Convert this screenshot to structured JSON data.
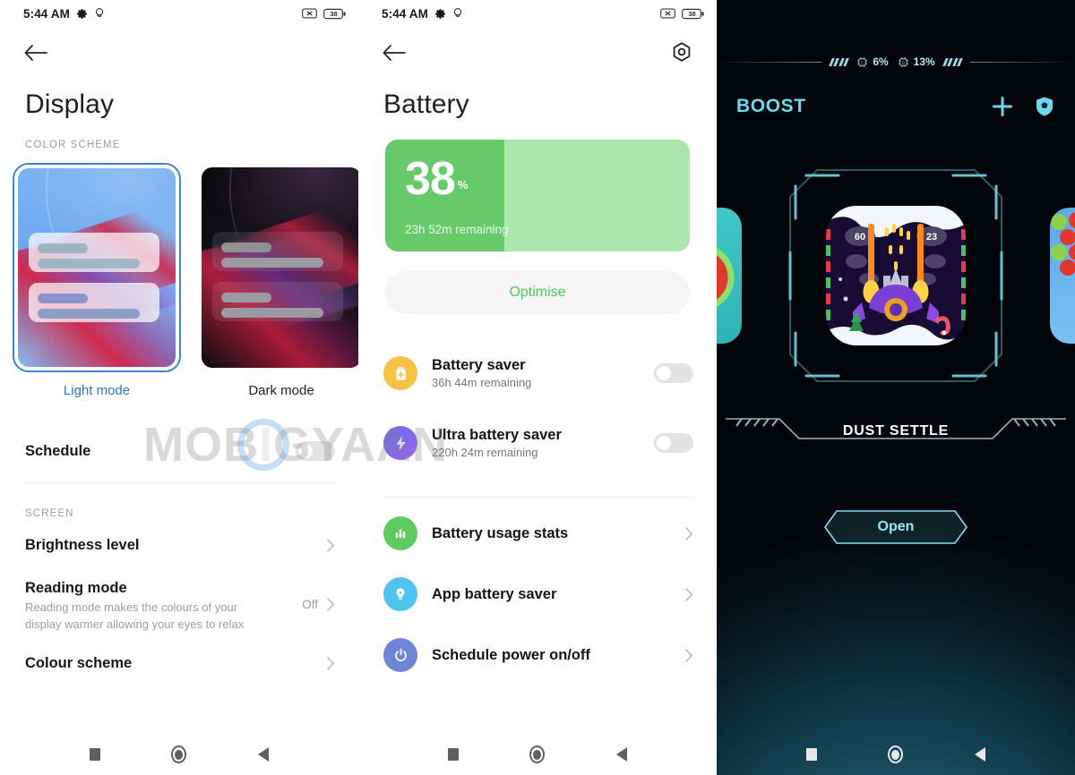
{
  "status_bar": {
    "time": "5:44 AM",
    "icons_left": [
      "gear-icon",
      "location-icon"
    ],
    "icons_right": [
      "no-sim-icon",
      "battery-icon"
    ],
    "battery_level": "38"
  },
  "display_screen": {
    "title": "Display",
    "back_icon": "back-arrow-icon",
    "section_color_scheme": "COLOR SCHEME",
    "modes": [
      {
        "label": "Light mode",
        "selected": true
      },
      {
        "label": "Dark mode",
        "selected": false
      }
    ],
    "schedule": {
      "label": "Schedule",
      "toggle_state": "off"
    },
    "section_screen": "SCREEN",
    "items": [
      {
        "title": "Brightness level",
        "subtitle": "",
        "value": ""
      },
      {
        "title": "Reading mode",
        "subtitle": "Reading mode makes the colours of your display warmer allowing your eyes to relax",
        "value": "Off"
      },
      {
        "title": "Colour scheme",
        "subtitle": "",
        "value": ""
      }
    ]
  },
  "battery_screen": {
    "title": "Battery",
    "back_icon": "back-arrow-icon",
    "settings_icon": "hex-nut-icon",
    "battery_card": {
      "percent": "38",
      "percent_symbol": "%",
      "remaining": "23h 52m remaining",
      "fill_color": "#66ca6a",
      "track_color": "#abe6ac"
    },
    "optimise_button": "Optimise",
    "savers": [
      {
        "title": "Battery saver",
        "subtitle": "36h 44m remaining",
        "icon": "battery-plus-icon",
        "icon_color": "#f5c243",
        "toggle_state": "off"
      },
      {
        "title": "Ultra battery saver",
        "subtitle": "220h 24m remaining",
        "icon": "bolt-icon",
        "icon_color": "#7b62ef",
        "toggle_state": "off"
      }
    ],
    "links": [
      {
        "title": "Battery usage stats",
        "icon": "bar-chart-icon",
        "icon_color": "#5ecb60"
      },
      {
        "title": "App battery saver",
        "icon": "bulb-bolt-icon",
        "icon_color": "#4ec3f0"
      },
      {
        "title": "Schedule power on/off",
        "icon": "power-icon",
        "icon_color": "#6f86d8"
      }
    ]
  },
  "game_turbo_screen": {
    "hud": {
      "cpu_icon": "cpu-chip-icon",
      "cpu_value": "6%",
      "gpu_icon": "gpu-chip-icon",
      "gpu_value": "13%"
    },
    "boost_label": "BOOST",
    "add_icon": "plus-icon",
    "shield_icon": "shield-gem-icon",
    "game_name": "DUST SETTLE",
    "open_button": "Open",
    "accent_color": "#6fd8ef"
  },
  "navigation_bar": {
    "recents": "recents-square-icon",
    "home": "home-circle-icon",
    "back": "back-triangle-icon"
  },
  "watermark": {
    "text": "MOBIGYAAN"
  }
}
